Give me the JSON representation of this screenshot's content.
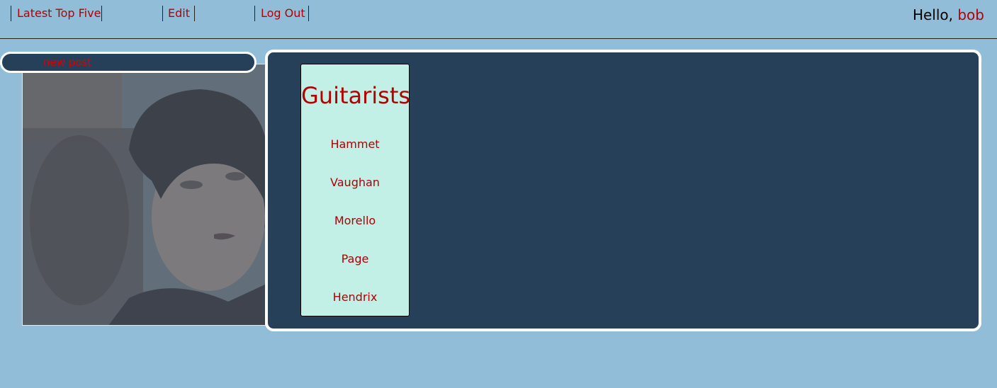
{
  "nav": {
    "links": [
      "Latest Top Five",
      "Edit",
      "Log Out"
    ]
  },
  "greeting": {
    "prefix": "Hello,",
    "username": "bob"
  },
  "sidebar": {
    "new_post_label": "new post"
  },
  "list": {
    "title": "Guitarists",
    "items": [
      "Hammet",
      "Vaughan",
      "Morello",
      "Page",
      "Hendrix"
    ]
  },
  "colors": {
    "page_background": "#92bdd8",
    "panel_background": "#27405a",
    "card_background": "#c3f0e6",
    "link_red": "#b30000"
  }
}
